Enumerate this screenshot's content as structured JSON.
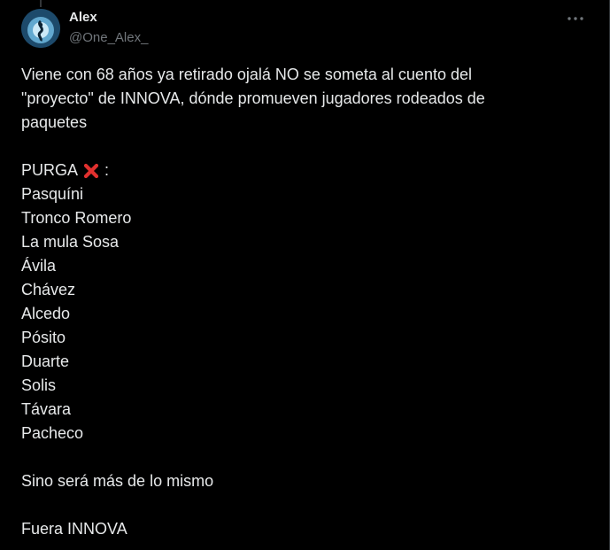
{
  "author": {
    "name": "Alex",
    "handle": "@One_Alex_"
  },
  "icons": {
    "more": "more-horizontal-icon",
    "x_mark": "cross-mark-emoji",
    "avatar": "avatar-image"
  },
  "colors": {
    "background": "#000000",
    "text": "#e7e9ea",
    "secondary_text": "#71767b",
    "x_mark": "#e0302e"
  },
  "tweet": {
    "intro": "Viene con 68 años ya retirado ojalá NO se someta al cuento del \"proyecto\" de INNOVA, dónde promueven jugadores rodeados de paquetes",
    "intro_lines": [
      "Viene con 68 años ya retirado ojalá NO se someta al cuento del",
      "\"proyecto\" de INNOVA, dónde promueven jugadores rodeados de",
      "paquetes"
    ],
    "purga_label": "PURGA",
    "purga_suffix": ":",
    "purga_list": [
      "Pasquíni",
      "Tronco Romero",
      "La mula Sosa",
      "Ávila",
      "Chávez",
      "Alcedo",
      "Pósito",
      "Duarte",
      "Solis",
      "Távara",
      "Pacheco"
    ],
    "closing_1": "Sino será más de lo mismo",
    "closing_2": "Fuera INNOVA"
  }
}
